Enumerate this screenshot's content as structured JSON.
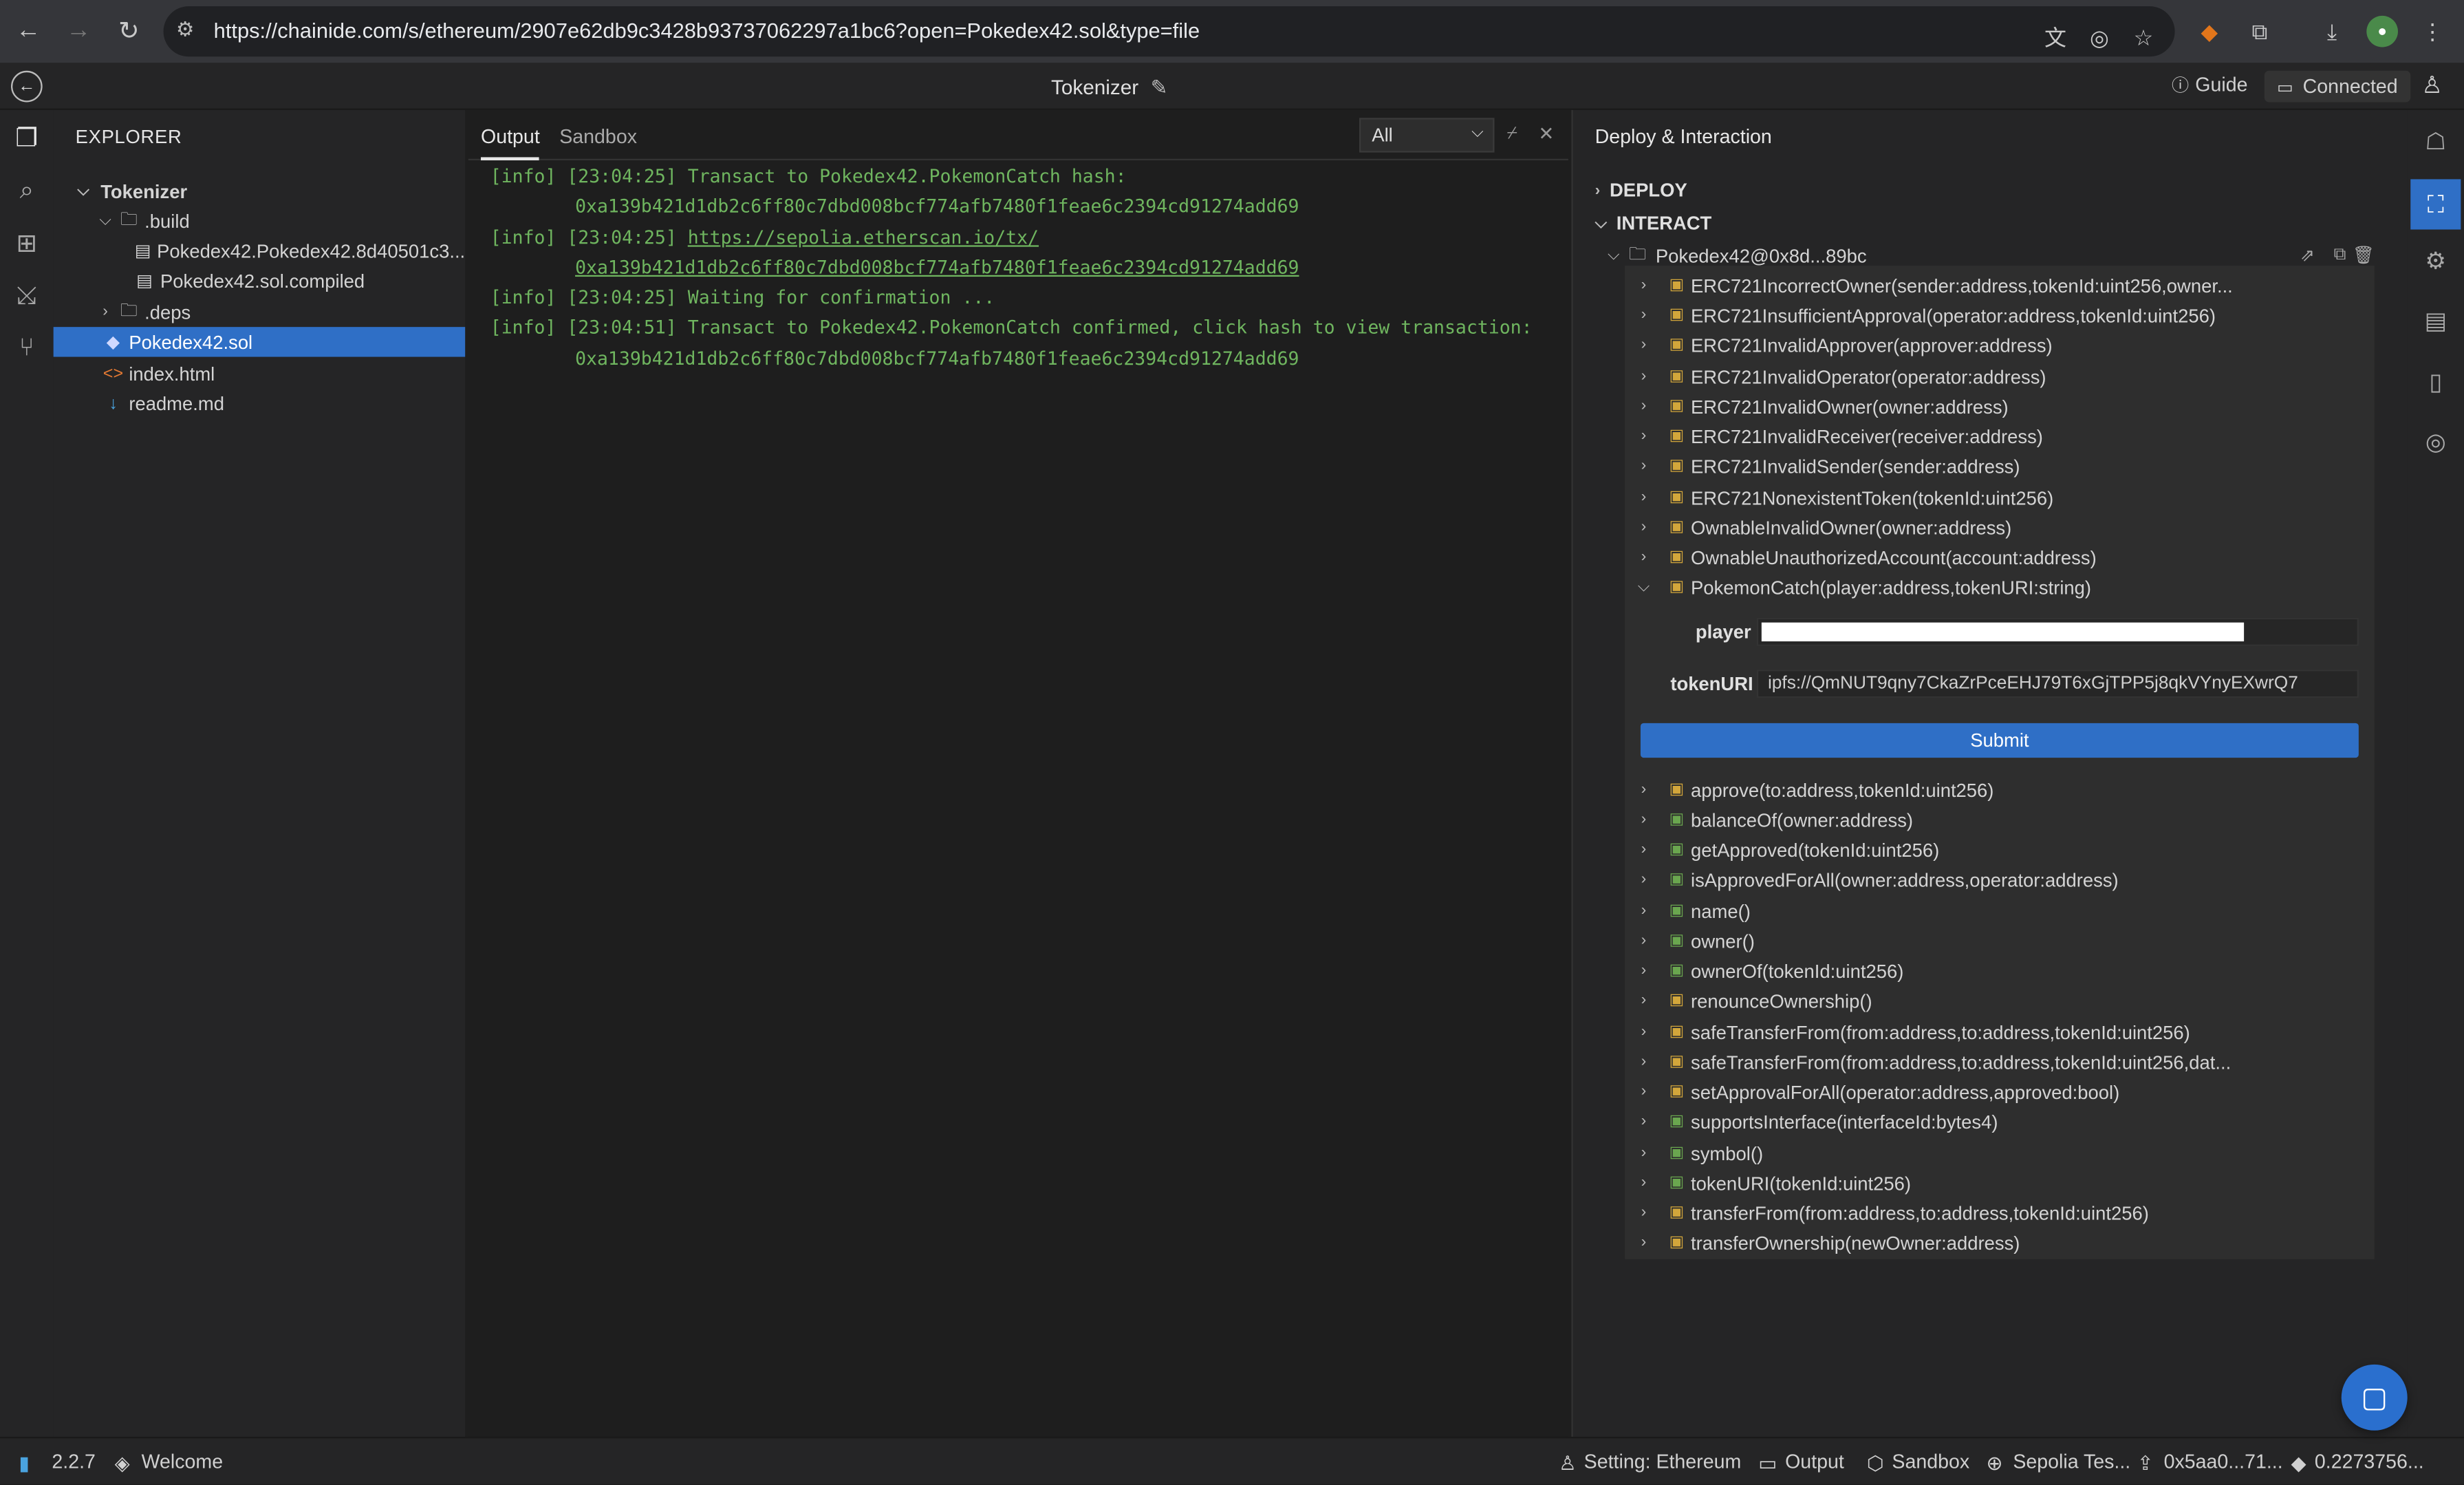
{
  "browser": {
    "url": "https://chainide.com/s/ethereum/2907e62db9c3428b93737062297a1bc6?open=Pokedex42.sol&type=file"
  },
  "header": {
    "project_title": "Tokenizer",
    "guide_label": "Guide",
    "connected_label": "Connected"
  },
  "explorer": {
    "title": "EXPLORER",
    "root": "Tokenizer",
    "build_folder": ".build",
    "build_files": [
      "Pokedex42.Pokedex42.8d40501c3...",
      "Pokedex42.sol.compiled"
    ],
    "deps_folder": ".deps",
    "files": [
      "Pokedex42.sol",
      "index.html",
      "readme.md"
    ]
  },
  "output": {
    "tabs": [
      "Output",
      "Sandbox"
    ],
    "filter_value": "All",
    "logs": [
      "[info] [23:04:25] Transact to Pokedex42.PokemonCatch hash:",
      "0xa139b421d1db2c6ff80c7dbd008bcf774afb7480f1feae6c2394cd91274add69",
      "[info] [23:04:25] ",
      "https://sepolia.etherscan.io/tx/",
      "0xa139b421d1db2c6ff80c7dbd008bcf774afb7480f1feae6c2394cd91274add69",
      "[info] [23:04:25] Waiting for confirmation ...",
      "[info] [23:04:51] Transact to Pokedex42.PokemonCatch confirmed, click hash to view transaction:",
      "0xa139b421d1db2c6ff80c7dbd008bcf774afb7480f1feae6c2394cd91274add69"
    ]
  },
  "deploy": {
    "title": "Deploy & Interaction",
    "deploy_label": "DEPLOY",
    "interact_label": "INTERACT",
    "contract": "Pokedex42@0x8d...89bc",
    "write_functions": [
      "ERC721IncorrectOwner(sender:address,tokenId:uint256,owner...",
      "ERC721InsufficientApproval(operator:address,tokenId:uint256)",
      "ERC721InvalidApprover(approver:address)",
      "ERC721InvalidOperator(operator:address)",
      "ERC721InvalidOwner(owner:address)",
      "ERC721InvalidReceiver(receiver:address)",
      "ERC721InvalidSender(sender:address)",
      "ERC721NonexistentToken(tokenId:uint256)",
      "OwnableInvalidOwner(owner:address)",
      "OwnableUnauthorizedAccount(account:address)",
      "PokemonCatch(player:address,tokenURI:string)"
    ],
    "expanded_params": {
      "player_label": "player",
      "player_value": "",
      "tokenuri_label": "tokenURI",
      "tokenuri_value": "ipfs://QmNUT9qny7CkaZrPceEHJ79T6xGjTPP5j8qkVYnyEXwrQ7",
      "submit_label": "Submit"
    },
    "more_functions": [
      "approve(to:address,tokenId:uint256)",
      "balanceOf(owner:address)",
      "getApproved(tokenId:uint256)",
      "isApprovedForAll(owner:address,operator:address)",
      "name()",
      "owner()",
      "ownerOf(tokenId:uint256)",
      "renounceOwnership()",
      "safeTransferFrom(from:address,to:address,tokenId:uint256)",
      "safeTransferFrom(from:address,to:address,tokenId:uint256,dat...",
      "setApprovalForAll(operator:address,approved:bool)",
      "supportsInterface(interfaceId:bytes4)",
      "symbol()",
      "tokenURI(tokenId:uint256)",
      "transferFrom(from:address,to:address,tokenId:uint256)",
      "transferOwnership(newOwner:address)"
    ]
  },
  "statusbar": {
    "version": "2.2.7",
    "welcome": "Welcome",
    "setting": "Setting: Ethereum",
    "output": "Output",
    "sandbox": "Sandbox",
    "network": "Sepolia Tes...",
    "account": "0x5aa0...71...",
    "balance": "0.2273756..."
  },
  "colors": {
    "accent": "#2f6fc6",
    "log_green": "#6fb55f",
    "write_fn": "#d2a63b",
    "read_fn": "#6aa64f"
  }
}
